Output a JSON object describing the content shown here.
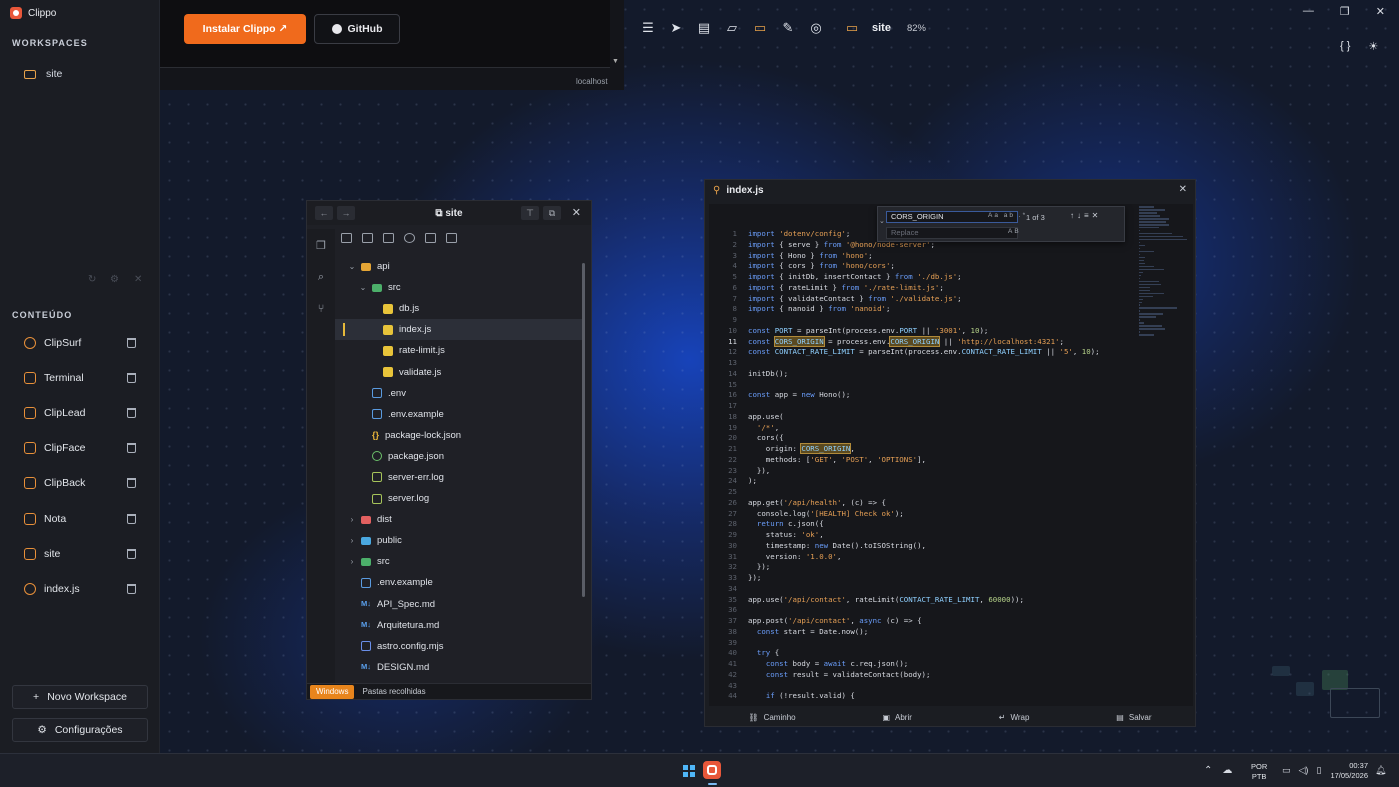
{
  "app": {
    "title": "Clippo"
  },
  "sidebar": {
    "workspaces_title": "WORKSPACES",
    "workspaces": [
      {
        "label": "site",
        "icon": "folder-icon"
      }
    ],
    "content_title": "CONTEÚDO",
    "content_items": [
      {
        "label": "ClipSurf",
        "icon": "globe-icon"
      },
      {
        "label": "Terminal",
        "icon": "terminal-icon"
      },
      {
        "label": "ClipLead",
        "icon": "clipboard-icon"
      },
      {
        "label": "ClipFace",
        "icon": "clipboard-icon"
      },
      {
        "label": "ClipBack",
        "icon": "clipboard-icon"
      },
      {
        "label": "Nota",
        "icon": "note-icon"
      },
      {
        "label": "site",
        "icon": "folder-icon"
      },
      {
        "label": "index.js",
        "icon": "eye-icon"
      }
    ],
    "new_workspace": "Novo Workspace",
    "settings": "Configurações"
  },
  "browser": {
    "install_button": "Instalar Clippo ↗",
    "github_button": "GitHub",
    "url": "localhost"
  },
  "toolbar": {
    "folder": "site",
    "zoom": "82%"
  },
  "explorer": {
    "title": "site",
    "tree": [
      {
        "label": "api",
        "kind": "folder",
        "depth": 1,
        "chevron": "⌄"
      },
      {
        "label": "src",
        "kind": "src",
        "depth": 2,
        "chevron": "⌄"
      },
      {
        "label": "db.js",
        "kind": "js",
        "depth": 3
      },
      {
        "label": "index.js",
        "kind": "js",
        "depth": 3,
        "selected": true
      },
      {
        "label": "rate-limit.js",
        "kind": "js",
        "depth": 3
      },
      {
        "label": "validate.js",
        "kind": "js",
        "depth": 3
      },
      {
        "label": ".env",
        "kind": "env",
        "depth": 2
      },
      {
        "label": ".env.example",
        "kind": "env",
        "depth": 2
      },
      {
        "label": "package-lock.json",
        "kind": "json",
        "depth": 2
      },
      {
        "label": "package.json",
        "kind": "pkg",
        "depth": 2
      },
      {
        "label": "server-err.log",
        "kind": "log",
        "depth": 2
      },
      {
        "label": "server.log",
        "kind": "log",
        "depth": 2
      },
      {
        "label": "dist",
        "kind": "dist",
        "depth": 1,
        "chevron": "›"
      },
      {
        "label": "public",
        "kind": "public",
        "depth": 1,
        "chevron": "›"
      },
      {
        "label": "src",
        "kind": "src",
        "depth": 1,
        "chevron": "›"
      },
      {
        "label": ".env.example",
        "kind": "env",
        "depth": 1
      },
      {
        "label": "API_Spec.md",
        "kind": "md",
        "depth": 1
      },
      {
        "label": "Arquitetura.md",
        "kind": "md",
        "depth": 1
      },
      {
        "label": "astro.config.mjs",
        "kind": "mjs",
        "depth": 1
      },
      {
        "label": "DESIGN.md",
        "kind": "md",
        "depth": 1
      }
    ],
    "footer_pill": "Windows",
    "footer_text": "Pastas recolhidas"
  },
  "editor": {
    "title": "index.js",
    "find": {
      "query": "CORS_ORIGIN",
      "replace_placeholder": "Replace",
      "count": "1 of 3"
    },
    "current_line": 11,
    "lines": [
      "import 'dotenv/config';",
      "import { serve } from '@hono/node-server';",
      "import { Hono } from 'hono';",
      "import { cors } from 'hono/cors';",
      "import { initDb, insertContact } from './db.js';",
      "import { rateLimit } from './rate-limit.js';",
      "import { validateContact } from './validate.js';",
      "import { nanoid } from 'nanoid';",
      "",
      "const PORT = parseInt(process.env.PORT || '3001', 10);",
      "const CORS_ORIGIN = process.env.CORS_ORIGIN || 'http://localhost:4321';",
      "const CONTACT_RATE_LIMIT = parseInt(process.env.CONTACT_RATE_LIMIT || '5', 10);",
      "",
      "initDb();",
      "",
      "const app = new Hono();",
      "",
      "app.use(",
      "  '/*',",
      "  cors({",
      "    origin: CORS_ORIGIN,",
      "    methods: ['GET', 'POST', 'OPTIONS'],",
      "  }),",
      ");",
      "",
      "app.get('/api/health', (c) => {",
      "  console.log('[HEALTH] Check ok');",
      "  return c.json({",
      "    status: 'ok',",
      "    timestamp: new Date().toISOString(),",
      "    version: '1.0.0',",
      "  });",
      "});",
      "",
      "app.use('/api/contact', rateLimit(CONTACT_RATE_LIMIT, 60000));",
      "",
      "app.post('/api/contact', async (c) => {",
      "  const start = Date.now();",
      "",
      "  try {",
      "    const body = await c.req.json();",
      "    const result = validateContact(body);",
      "",
      "    if (!result.valid) {"
    ],
    "footer": [
      {
        "label": "Caminho",
        "icon": "link-icon"
      },
      {
        "label": "Abrir",
        "icon": "open-icon"
      },
      {
        "label": "Wrap",
        "icon": "wrap-icon"
      },
      {
        "label": "Salvar",
        "icon": "save-icon"
      }
    ]
  },
  "taskbar": {
    "lang_top": "POR",
    "lang_bottom": "PTB",
    "time": "00:37",
    "date": "17/05/2026"
  }
}
